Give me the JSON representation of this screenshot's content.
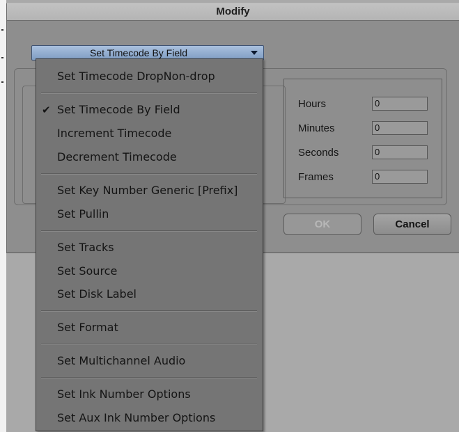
{
  "dialog": {
    "title": "Modify"
  },
  "dropdown": {
    "selected": "Set Timecode By Field"
  },
  "timecode": {
    "fields": [
      {
        "label": "Hours",
        "value": "0"
      },
      {
        "label": "Minutes",
        "value": "0"
      },
      {
        "label": "Seconds",
        "value": "0"
      },
      {
        "label": "Frames",
        "value": "0"
      }
    ]
  },
  "buttons": {
    "ok": "OK",
    "cancel": "Cancel"
  },
  "menu": {
    "items": [
      {
        "label": "Set Timecode DropNon-drop"
      },
      {
        "label": "Set Timecode By Field",
        "checked": true,
        "check_glyph": "✔"
      },
      {
        "label": "Increment Timecode"
      },
      {
        "label": "Decrement Timecode"
      },
      {
        "label": "Set Key Number Generic [Prefix]"
      },
      {
        "label": "Set Pullin"
      },
      {
        "label": "Set Tracks"
      },
      {
        "label": "Set Source"
      },
      {
        "label": "Set Disk Label"
      },
      {
        "label": "Set Format"
      },
      {
        "label": "Set Multichannel Audio"
      },
      {
        "label": "Set Ink Number Options"
      },
      {
        "label": "Set Aux Ink Number Options"
      }
    ]
  }
}
